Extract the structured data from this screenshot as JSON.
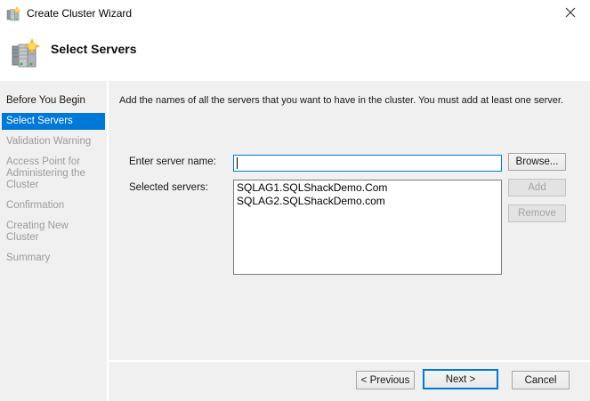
{
  "window": {
    "title": "Create Cluster Wizard"
  },
  "header": {
    "title": "Select Servers"
  },
  "sidebar": {
    "items": [
      {
        "label": "Before You Begin",
        "state": "visited"
      },
      {
        "label": "Select Servers",
        "state": "current"
      },
      {
        "label": "Validation Warning",
        "state": "upcoming"
      },
      {
        "label": "Access Point for Administering the Cluster",
        "state": "upcoming"
      },
      {
        "label": "Confirmation",
        "state": "upcoming"
      },
      {
        "label": "Creating New Cluster",
        "state": "upcoming"
      },
      {
        "label": "Summary",
        "state": "upcoming"
      }
    ]
  },
  "content": {
    "instruction": "Add the names of all the servers that you want to have in the cluster. You must add at least one server.",
    "server_name": {
      "label": "Enter server name:",
      "value": "",
      "browse_label": "Browse..."
    },
    "selected_servers": {
      "label": "Selected servers:",
      "items": [
        "SQLAG1.SQLShackDemo.Com",
        "SQLAG2.SQLShackDemo.com"
      ],
      "add_label": "Add",
      "remove_label": "Remove"
    }
  },
  "footer": {
    "previous_label": "< Previous",
    "next_label": "Next >",
    "cancel_label": "Cancel"
  },
  "icons": {
    "titlebar": "cluster-servers-with-star",
    "header": "cluster-servers-with-star",
    "close": "close-x"
  },
  "colors": {
    "accent_blue": "#0078d7",
    "body_background": "#f0f0f0",
    "panel_white": "#ffffff",
    "disabled_text": "#a3a3a3",
    "upcoming_step_text": "#9b9b9b",
    "star_yellow": "#ffcc33"
  }
}
